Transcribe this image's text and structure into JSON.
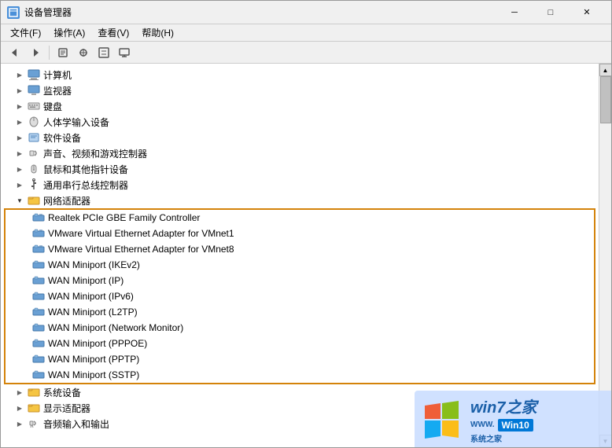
{
  "window": {
    "title": "设备管理器",
    "title_icon": "⚙"
  },
  "menu": {
    "items": [
      "文件(F)",
      "操作(A)",
      "查看(V)",
      "帮助(H)"
    ]
  },
  "toolbar": {
    "buttons": [
      "←",
      "→",
      "⊞",
      "ℹ",
      "⊞",
      "🖥"
    ]
  },
  "tree": {
    "items": [
      {
        "label": "计算机",
        "indent": 0,
        "collapsed": true,
        "hasIcon": true,
        "iconType": "computer"
      },
      {
        "label": "监视器",
        "indent": 0,
        "collapsed": true,
        "hasIcon": true,
        "iconType": "monitor"
      },
      {
        "label": "键盘",
        "indent": 0,
        "collapsed": true,
        "hasIcon": true,
        "iconType": "keyboard"
      },
      {
        "label": "人体学输入设备",
        "indent": 0,
        "collapsed": true,
        "hasIcon": true,
        "iconType": "hid"
      },
      {
        "label": "软件设备",
        "indent": 0,
        "collapsed": true,
        "hasIcon": true,
        "iconType": "software"
      },
      {
        "label": "声音、视频和游戏控制器",
        "indent": 0,
        "collapsed": true,
        "hasIcon": true,
        "iconType": "audio"
      },
      {
        "label": "鼠标和其他指针设备",
        "indent": 0,
        "collapsed": true,
        "hasIcon": true,
        "iconType": "mouse"
      },
      {
        "label": "通用串行总线控制器",
        "indent": 0,
        "collapsed": true,
        "hasIcon": true,
        "iconType": "usb"
      },
      {
        "label": "网络适配器",
        "indent": 0,
        "collapsed": false,
        "hasIcon": true,
        "iconType": "network"
      }
    ],
    "networkChildren": [
      "Realtek PCIe GBE Family Controller",
      "VMware Virtual Ethernet Adapter for VMnet1",
      "VMware Virtual Ethernet Adapter for VMnet8",
      "WAN Miniport (IKEv2)",
      "WAN Miniport (IP)",
      "WAN Miniport (IPv6)",
      "WAN Miniport (L2TP)",
      "WAN Miniport (Network Monitor)",
      "WAN Miniport (PPPOE)",
      "WAN Miniport (PPTP)",
      "WAN Miniport (SSTP)"
    ],
    "bottomItems": [
      {
        "label": "系统设备",
        "indent": 0,
        "collapsed": true,
        "iconType": "system"
      },
      {
        "label": "显示适配器",
        "indent": 0,
        "collapsed": true,
        "iconType": "display"
      },
      {
        "label": "音频输入和输出",
        "indent": 0,
        "collapsed": true,
        "iconType": "audio2"
      }
    ]
  },
  "watermark": {
    "win7_text": "win7之家",
    "www_text": "WWW.",
    "win10_text": "Win10",
    "win10_sub": "系统之家"
  }
}
